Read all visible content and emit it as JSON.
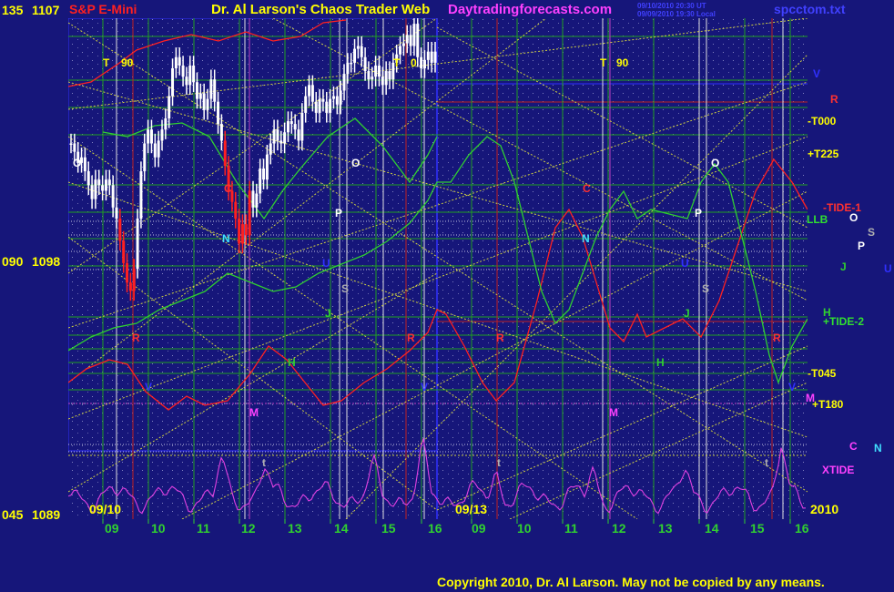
{
  "header": {
    "ticker": "S&P E-Mini",
    "title": "Dr. Al Larson's Chaos Trader Web",
    "site": "Daytradingforecasts.com",
    "stamp1": "09/10/2010 20:30 UT",
    "stamp2": "09/09/2010 19:30 Local",
    "file": "spcctom.txt"
  },
  "copyright": "Copyright 2010, Dr. Al Larson. May not be copied by any means.",
  "colors": {
    "background": "#16167a",
    "price_bars": "#ffffff",
    "red_line": "#ff2020",
    "green_line": "#30d030",
    "magenta_line": "#e040e0",
    "yellow_text": "#ffff00",
    "grid_green": "#20a020",
    "dotted_yellow": "#d0d040"
  },
  "chart_data": {
    "type": "line",
    "title": "S&P E-Mini",
    "y_tick_labels": [
      {
        "angle": "135",
        "price": "1107"
      },
      {
        "angle": "090",
        "price": "1098"
      },
      {
        "angle": "045",
        "price": "1089"
      }
    ],
    "ylim": [
      1089,
      1107
    ],
    "x_tick_labels": [
      "09",
      "10",
      "11",
      "12",
      "13",
      "14",
      "15",
      "16",
      "09",
      "10",
      "11",
      "12",
      "13",
      "14",
      "15",
      "16"
    ],
    "date_labels": [
      "09/10",
      "09/13"
    ],
    "year_label": "2010",
    "series_labels": [
      {
        "text": "-T000",
        "color": "#ffff00"
      },
      {
        "text": "+T225",
        "color": "#ffff00"
      },
      {
        "text": "-TIDE-1",
        "color": "#ff3030"
      },
      {
        "text": "LLB",
        "color": "#30e030"
      },
      {
        "text": "+TIDE-2",
        "color": "#30e030"
      },
      {
        "text": "-T045",
        "color": "#ffff00"
      },
      {
        "text": "+T180",
        "color": "#ffff00"
      },
      {
        "text": "XTIDE",
        "color": "#ff40ff"
      }
    ],
    "planet_letters": [
      {
        "text": "T",
        "color": "#ffff00"
      },
      {
        "text": "90",
        "color": "#ffff00"
      },
      {
        "text": "T",
        "color": "#ffff00"
      },
      {
        "text": "0",
        "color": "#ffff00"
      },
      {
        "text": "T",
        "color": "#ffff00"
      },
      {
        "text": "90",
        "color": "#ffff00"
      },
      {
        "text": "O",
        "color": "#ffffff"
      },
      {
        "text": "O",
        "color": "#ffffff"
      },
      {
        "text": "O",
        "color": "#ffffff"
      },
      {
        "text": "O",
        "color": "#ffffff"
      },
      {
        "text": "C",
        "color": "#ff3030"
      },
      {
        "text": "C",
        "color": "#ff3030"
      },
      {
        "text": "C",
        "color": "#ff40ff"
      },
      {
        "text": "N",
        "color": "#40e0ff"
      },
      {
        "text": "N",
        "color": "#40e0ff"
      },
      {
        "text": "N",
        "color": "#40e0ff"
      },
      {
        "text": "P",
        "color": "#ffffff"
      },
      {
        "text": "P",
        "color": "#ffffff"
      },
      {
        "text": "P",
        "color": "#ffffff"
      },
      {
        "text": "S",
        "color": "#b0b0b0"
      },
      {
        "text": "S",
        "color": "#b0b0b0"
      },
      {
        "text": "S",
        "color": "#b0b0b0"
      },
      {
        "text": "U",
        "color": "#3030ff"
      },
      {
        "text": "U",
        "color": "#3030ff"
      },
      {
        "text": "U",
        "color": "#3030ff"
      },
      {
        "text": "J",
        "color": "#30d030"
      },
      {
        "text": "J",
        "color": "#30d030"
      },
      {
        "text": "J",
        "color": "#30d030"
      },
      {
        "text": "R",
        "color": "#ff3030"
      },
      {
        "text": "R",
        "color": "#ff3030"
      },
      {
        "text": "R",
        "color": "#ff3030"
      },
      {
        "text": "R",
        "color": "#ff3030"
      },
      {
        "text": "R",
        "color": "#ff3030"
      },
      {
        "text": "V",
        "color": "#3030ff"
      },
      {
        "text": "V",
        "color": "#3030ff"
      },
      {
        "text": "V",
        "color": "#3030ff"
      },
      {
        "text": "V",
        "color": "#3030ff"
      },
      {
        "text": "H",
        "color": "#30d030"
      },
      {
        "text": "H",
        "color": "#30d030"
      },
      {
        "text": "H",
        "color": "#30d030"
      },
      {
        "text": "M",
        "color": "#ff40ff"
      },
      {
        "text": "M",
        "color": "#ff40ff"
      },
      {
        "text": "M",
        "color": "#ff40ff"
      },
      {
        "text": "t",
        "color": "#b0b0b0"
      },
      {
        "text": "t",
        "color": "#b0b0b0"
      },
      {
        "text": "t",
        "color": "#b0b0b0"
      },
      {
        "text": "N",
        "color": "#40e0ff"
      }
    ],
    "price_series": {
      "name": "S&P E-Mini",
      "values": [
        1102.5,
        1102.2,
        1101.8,
        1102.0,
        1101.5,
        1101.0,
        1100.5,
        1101.2,
        1101.0,
        1100.8,
        1101.2,
        1101.0,
        1100.2,
        1099.8,
        1099.0,
        1098.2,
        1097.5,
        1097.2,
        1098.0,
        1099.8,
        1101.5,
        1102.5,
        1103.0,
        1102.5,
        1102.0,
        1102.6,
        1103.0,
        1103.4,
        1104.2,
        1105.2,
        1105.6,
        1105.3,
        1104.9,
        1104.6,
        1105.3,
        1104.7,
        1104.1,
        1104.3,
        1103.7,
        1104.1,
        1104.8,
        1104.0,
        1103.2,
        1102.6,
        1101.7,
        1100.8,
        1100.4,
        1099.8,
        1098.9,
        1099.6,
        1099.2,
        1100.8,
        1100.2,
        1100.7,
        1101.6,
        1101.2,
        1102.1,
        1102.5,
        1103.0,
        1102.6,
        1102.5,
        1102.9,
        1103.3,
        1103.2,
        1103.0,
        1102.6,
        1103.6,
        1104.2,
        1104.6,
        1104.0,
        1103.6,
        1104.1,
        1104.0,
        1103.6,
        1104.1,
        1104.2,
        1103.9,
        1104.4,
        1105.0,
        1105.4,
        1105.4,
        1105.9,
        1106.0,
        1105.6,
        1105.1,
        1104.8,
        1104.9,
        1105.3,
        1104.9,
        1104.6,
        1105.1,
        1104.8,
        1105.4,
        1105.7,
        1106.0,
        1106.1,
        1106.4,
        1106.0,
        1106.8,
        1105.6,
        1105.2,
        1105.5,
        1105.8,
        1105.4,
        1105.8
      ]
    }
  }
}
